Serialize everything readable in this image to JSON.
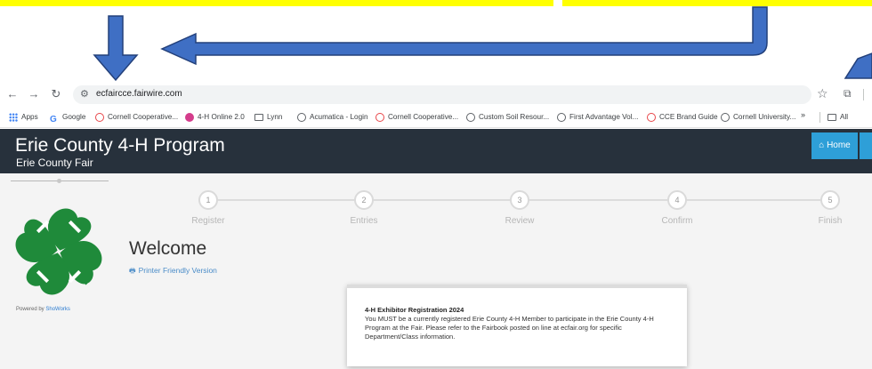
{
  "browser": {
    "url": "ecfaircce.fairwire.com",
    "nav_icons": [
      "back-arrow-icon",
      "forward-arrow-icon",
      "reload-icon",
      "site-info-icon"
    ],
    "bookmarks": [
      {
        "label": "Apps",
        "icon": "apps-grid-icon"
      },
      {
        "label": "Google",
        "icon": "google-icon"
      },
      {
        "label": "Cornell Cooperative...",
        "icon": "cornell-icon"
      },
      {
        "label": "4-H Online 2.0",
        "icon": "4h-online-icon"
      },
      {
        "label": "Lynn",
        "icon": "folder-icon"
      },
      {
        "label": "Acumatica - Login",
        "icon": "globe-icon"
      },
      {
        "label": "Cornell Cooperative...",
        "icon": "cornell-icon"
      },
      {
        "label": "Custom Soil Resour...",
        "icon": "globe-icon"
      },
      {
        "label": "First Advantage Vol...",
        "icon": "globe-icon"
      },
      {
        "label": "CCE Brand Guide",
        "icon": "cornell-icon"
      },
      {
        "label": "Cornell University...",
        "icon": "globe-icon"
      }
    ],
    "bookmarks_more": "»",
    "bookmarks_all": "All"
  },
  "site": {
    "title": "Erie County 4-H Program",
    "subtitle": "Erie County Fair",
    "home_button": "Home",
    "powered_by_prefix": "Powered by",
    "powered_by_link": "ShoWorks"
  },
  "steps": [
    {
      "number": "1",
      "label": "Register"
    },
    {
      "number": "2",
      "label": "Entries"
    },
    {
      "number": "3",
      "label": "Review"
    },
    {
      "number": "4",
      "label": "Confirm"
    },
    {
      "number": "5",
      "label": "Finish"
    }
  ],
  "main": {
    "heading": "Welcome",
    "printer_link": "Printer Friendly Version"
  },
  "notice": {
    "title": "4-H Exhibitor Registration 2024",
    "body": "You MUST be a currently registered Erie County 4-H Member to participate in the Erie County 4-H Program at the Fair.  Please refer to the Fairbook posted on line at ecfair.org for specific Department/Class information."
  },
  "colors": {
    "header_bg": "#27313c",
    "accent_blue": "#2e9fd8",
    "clover_green": "#1f8a3a",
    "annotation_arrow": "#3f6fc4",
    "highlight_yellow": "#ffff00"
  }
}
